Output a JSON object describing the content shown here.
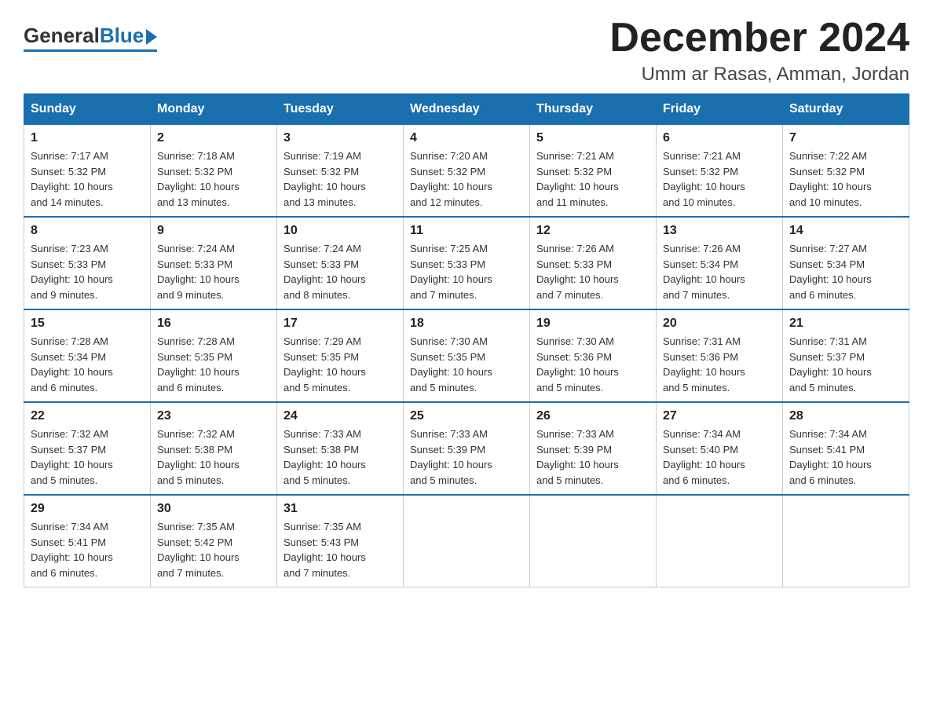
{
  "logo": {
    "general": "General",
    "blue": "Blue"
  },
  "header": {
    "month": "December 2024",
    "location": "Umm ar Rasas, Amman, Jordan"
  },
  "weekdays": [
    "Sunday",
    "Monday",
    "Tuesday",
    "Wednesday",
    "Thursday",
    "Friday",
    "Saturday"
  ],
  "weeks": [
    [
      {
        "day": "1",
        "sunrise": "7:17 AM",
        "sunset": "5:32 PM",
        "daylight": "10 hours and 14 minutes."
      },
      {
        "day": "2",
        "sunrise": "7:18 AM",
        "sunset": "5:32 PM",
        "daylight": "10 hours and 13 minutes."
      },
      {
        "day": "3",
        "sunrise": "7:19 AM",
        "sunset": "5:32 PM",
        "daylight": "10 hours and 13 minutes."
      },
      {
        "day": "4",
        "sunrise": "7:20 AM",
        "sunset": "5:32 PM",
        "daylight": "10 hours and 12 minutes."
      },
      {
        "day": "5",
        "sunrise": "7:21 AM",
        "sunset": "5:32 PM",
        "daylight": "10 hours and 11 minutes."
      },
      {
        "day": "6",
        "sunrise": "7:21 AM",
        "sunset": "5:32 PM",
        "daylight": "10 hours and 10 minutes."
      },
      {
        "day": "7",
        "sunrise": "7:22 AM",
        "sunset": "5:32 PM",
        "daylight": "10 hours and 10 minutes."
      }
    ],
    [
      {
        "day": "8",
        "sunrise": "7:23 AM",
        "sunset": "5:33 PM",
        "daylight": "10 hours and 9 minutes."
      },
      {
        "day": "9",
        "sunrise": "7:24 AM",
        "sunset": "5:33 PM",
        "daylight": "10 hours and 9 minutes."
      },
      {
        "day": "10",
        "sunrise": "7:24 AM",
        "sunset": "5:33 PM",
        "daylight": "10 hours and 8 minutes."
      },
      {
        "day": "11",
        "sunrise": "7:25 AM",
        "sunset": "5:33 PM",
        "daylight": "10 hours and 7 minutes."
      },
      {
        "day": "12",
        "sunrise": "7:26 AM",
        "sunset": "5:33 PM",
        "daylight": "10 hours and 7 minutes."
      },
      {
        "day": "13",
        "sunrise": "7:26 AM",
        "sunset": "5:34 PM",
        "daylight": "10 hours and 7 minutes."
      },
      {
        "day": "14",
        "sunrise": "7:27 AM",
        "sunset": "5:34 PM",
        "daylight": "10 hours and 6 minutes."
      }
    ],
    [
      {
        "day": "15",
        "sunrise": "7:28 AM",
        "sunset": "5:34 PM",
        "daylight": "10 hours and 6 minutes."
      },
      {
        "day": "16",
        "sunrise": "7:28 AM",
        "sunset": "5:35 PM",
        "daylight": "10 hours and 6 minutes."
      },
      {
        "day": "17",
        "sunrise": "7:29 AM",
        "sunset": "5:35 PM",
        "daylight": "10 hours and 5 minutes."
      },
      {
        "day": "18",
        "sunrise": "7:30 AM",
        "sunset": "5:35 PM",
        "daylight": "10 hours and 5 minutes."
      },
      {
        "day": "19",
        "sunrise": "7:30 AM",
        "sunset": "5:36 PM",
        "daylight": "10 hours and 5 minutes."
      },
      {
        "day": "20",
        "sunrise": "7:31 AM",
        "sunset": "5:36 PM",
        "daylight": "10 hours and 5 minutes."
      },
      {
        "day": "21",
        "sunrise": "7:31 AM",
        "sunset": "5:37 PM",
        "daylight": "10 hours and 5 minutes."
      }
    ],
    [
      {
        "day": "22",
        "sunrise": "7:32 AM",
        "sunset": "5:37 PM",
        "daylight": "10 hours and 5 minutes."
      },
      {
        "day": "23",
        "sunrise": "7:32 AM",
        "sunset": "5:38 PM",
        "daylight": "10 hours and 5 minutes."
      },
      {
        "day": "24",
        "sunrise": "7:33 AM",
        "sunset": "5:38 PM",
        "daylight": "10 hours and 5 minutes."
      },
      {
        "day": "25",
        "sunrise": "7:33 AM",
        "sunset": "5:39 PM",
        "daylight": "10 hours and 5 minutes."
      },
      {
        "day": "26",
        "sunrise": "7:33 AM",
        "sunset": "5:39 PM",
        "daylight": "10 hours and 5 minutes."
      },
      {
        "day": "27",
        "sunrise": "7:34 AM",
        "sunset": "5:40 PM",
        "daylight": "10 hours and 6 minutes."
      },
      {
        "day": "28",
        "sunrise": "7:34 AM",
        "sunset": "5:41 PM",
        "daylight": "10 hours and 6 minutes."
      }
    ],
    [
      {
        "day": "29",
        "sunrise": "7:34 AM",
        "sunset": "5:41 PM",
        "daylight": "10 hours and 6 minutes."
      },
      {
        "day": "30",
        "sunrise": "7:35 AM",
        "sunset": "5:42 PM",
        "daylight": "10 hours and 7 minutes."
      },
      {
        "day": "31",
        "sunrise": "7:35 AM",
        "sunset": "5:43 PM",
        "daylight": "10 hours and 7 minutes."
      },
      null,
      null,
      null,
      null
    ]
  ],
  "labels": {
    "sunrise": "Sunrise:",
    "sunset": "Sunset:",
    "daylight": "Daylight:"
  }
}
